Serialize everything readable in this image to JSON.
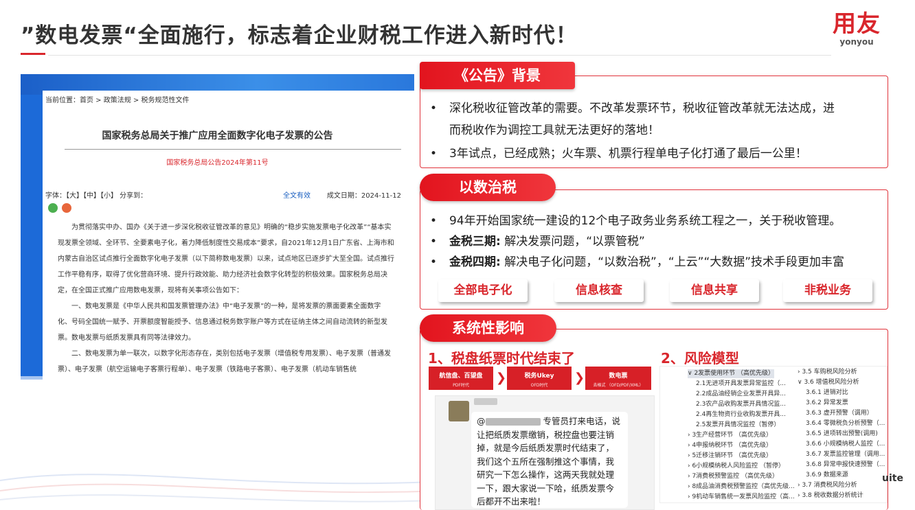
{
  "header": {
    "title": "”数电发票“全面施行，标志着企业财税工作进入新时代！",
    "logo_cn": "用友",
    "logo_en": "yonyou"
  },
  "doc": {
    "breadcrumb": "当前位置：首页 > 政策法规 > 税务规范性文件",
    "title": "国家税务总局关于推广应用全面数字化电子发票的公告",
    "number": "国家税务总局公告2024年第11号",
    "font_size": "字体：【大】【中】【小】 分享到：",
    "validity": "全文有效",
    "date": "成文日期：2024-11-12",
    "paragraphs": [
      "为贯彻落实中办、国办《关于进一步深化税收征管改革的意见》明确的“稳步实施发票电子化改革”“基本实现发票全领域、全环节、全要素电子化，着力降低制度性交易成本”要求，自2021年12月1日广东省、上海市和内蒙古自治区试点推行全面数字化电子发票（以下简称数电发票）以来，试点地区已逐步扩大至全国。试点推行工作平稳有序，取得了优化营商环境、提升行政效能、助力经济社会数字化转型的积极效果。国家税务总局决定，在全国正式推广应用数电发票，现将有关事项公告如下：",
      "一、数电发票是《中华人民共和国发票管理办法》中“电子发票”的一种，是将发票的票面要素全面数字化、号码全国统一赋予、开票额度智能授予、信息通过税务数字账户等方式在征纳主体之间自动流转的新型发票。数电发票与纸质发票具有同等法律效力。",
      "二、数电发票为单一联次，以数字化形态存在，类别包括电子发票（增值税专用发票）、电子发票（普通发票）、电子发票（航空运输电子客票行程单）、电子发票（铁路电子客票）、电子发票（机动车销售统"
    ]
  },
  "panel1": {
    "tag": "《公告》背景",
    "bullets": [
      "深化税收征管改革的需要。不改革发票环节，税收征管改革就无法达成，进",
      "而税收作为调控工具就无法更好的落地！",
      "3年试点，已经成熟；火车票、机票行程单电子化打通了最后一公里！"
    ],
    "dot": "•"
  },
  "panel2": {
    "tag": "以数治税",
    "line1": "94年开始国家统一建设的12个电子政务业务系统工程之一，关于税收管理。",
    "line2_bold": "金税三期:",
    "line2": " 解决发票问题，“以票管税”",
    "line3_bold": "金税四期:",
    "line3": " 解决电子化问题，“以数治税”，“上云”“大数据”技术手段更加丰富",
    "pills": [
      "全部电子化",
      "信息核查",
      "信息共享",
      "非税业务"
    ]
  },
  "panel3": {
    "tag": "系统性影响",
    "h1": "1、税盘纸票时代结束了",
    "h2": "2、风险模型",
    "flow": [
      {
        "label": "航信盘、百望盘",
        "sub": "PDF时代"
      },
      {
        "label": "税务Ukey",
        "sub": "OFD时代"
      },
      {
        "label": "数电票",
        "sub": "去格式 （OFD/PDF/XML）"
      }
    ],
    "arrow": "❯",
    "chat": {
      "mention": "@",
      "text": " 专管员打来电话，说让把纸质发票缴销，税控盘也要注销掉，就是今后纸质发票时代结束了，我们这个五所在强制推这个事情，我研究一下怎么操作，这两天我就处理一下，跟大家说一下哈，纸质发票今后都开不出来啦！"
    },
    "tree_left": [
      "∨ 2发票使用环节 （高优先级）",
      "2.1无进项开具发票异常监控（...",
      "2.2成品油经销企业发票开具异...",
      "2.3农产品收购发票开具情况监...",
      "2.4再生物资行业收购发票开具...",
      "2.5发票开具情况监控（暂停）",
      "› 3生产经营环节 （高优先级）",
      "› 4申报纳税环节 （高优先级）",
      "› 5迁移注销环节 （高优先级）",
      "› 6小规模纳税人风险监控 （暂停）",
      "› 7消费税预警监控 （高优先级）",
      "› 8成品油消费税预警监控（高优先级...",
      "› 9机动车销售统一发票风险监控（高..."
    ],
    "tree_right": [
      "› 3.5  车购税风险分析",
      "∨ 3.6  增值税风险分析",
      "3.6.1  进销对比",
      "3.6.2  异常发票",
      "3.6.3  虚开预警（调用）",
      "3.6.4  零微税负分析预警（...",
      "3.6.5  进项转出预警(调用)",
      "3.6.6  小规模纳税人监控（...",
      "3.6.7  发票监控管理（调用...",
      "3.6.8  异常申报快速预警（...",
      "3.6.9  数据来源",
      "› 3.7  消费税风险分析",
      "› 3.8  税收数据分析统计"
    ],
    "suite": "uite"
  }
}
